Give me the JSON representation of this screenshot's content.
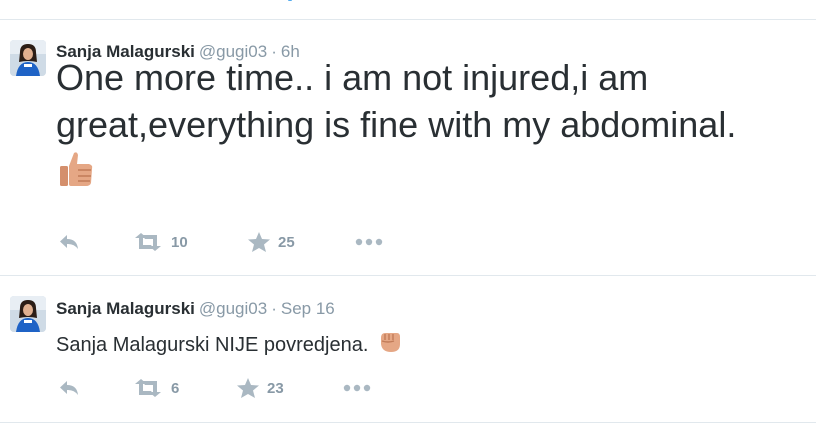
{
  "tweets": [
    {
      "fullname": "Sanja Malagurski",
      "username": "@gugi03",
      "separator": "·",
      "time": "6h",
      "text_line1": "One more time.. i am not injured,i am",
      "text_line2": "great,everything is fine with my abdominal.",
      "emoji": "thumbs-up-emoji",
      "retweets": "10",
      "favorites": "25"
    },
    {
      "fullname": "Sanja Malagurski",
      "username": "@gugi03",
      "separator": "·",
      "time": "Sep 16",
      "text": "Sanja Malagurski NIJE povredjena.",
      "emoji": "raised-fist-emoji",
      "retweets": "6",
      "favorites": "23"
    }
  ],
  "icons": {
    "reply": "reply-icon",
    "retweet": "retweet-icon",
    "favorite": "star-icon",
    "more": "more-icon"
  },
  "colors": {
    "action_gray": "#8899a6",
    "text": "#292f33",
    "divider": "#e1e8ed",
    "skin": "#e5a785"
  }
}
